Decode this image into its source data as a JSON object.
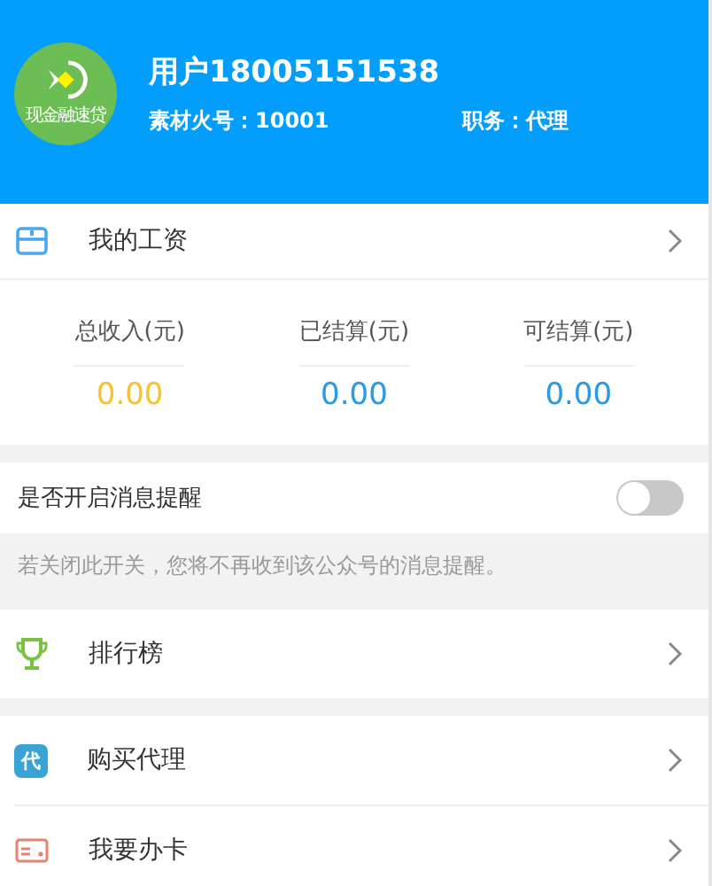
{
  "profile": {
    "logo_text": "现金融速贷",
    "username": "用户18005151538",
    "material_no": "素材火号：10001",
    "position": "职务：代理"
  },
  "salary": {
    "title": "我的工资",
    "stats": [
      {
        "label": "总收入(元)",
        "value": "0.00",
        "kind": "total"
      },
      {
        "label": "已结算(元)",
        "value": "0.00",
        "kind": "settled"
      },
      {
        "label": "可结算(元)",
        "value": "0.00",
        "kind": "available"
      }
    ]
  },
  "notification": {
    "label": "是否开启消息提醒",
    "on": false,
    "note": "若关闭此开关，您将不再收到该公众号的消息提醒。"
  },
  "menu_groups": [
    [
      {
        "label": "排行榜",
        "kind": "trophy"
      }
    ],
    [
      {
        "label": "购买代理",
        "kind": "agent",
        "icon_text": "代"
      },
      {
        "label": "我要办卡",
        "kind": "card"
      }
    ]
  ]
}
